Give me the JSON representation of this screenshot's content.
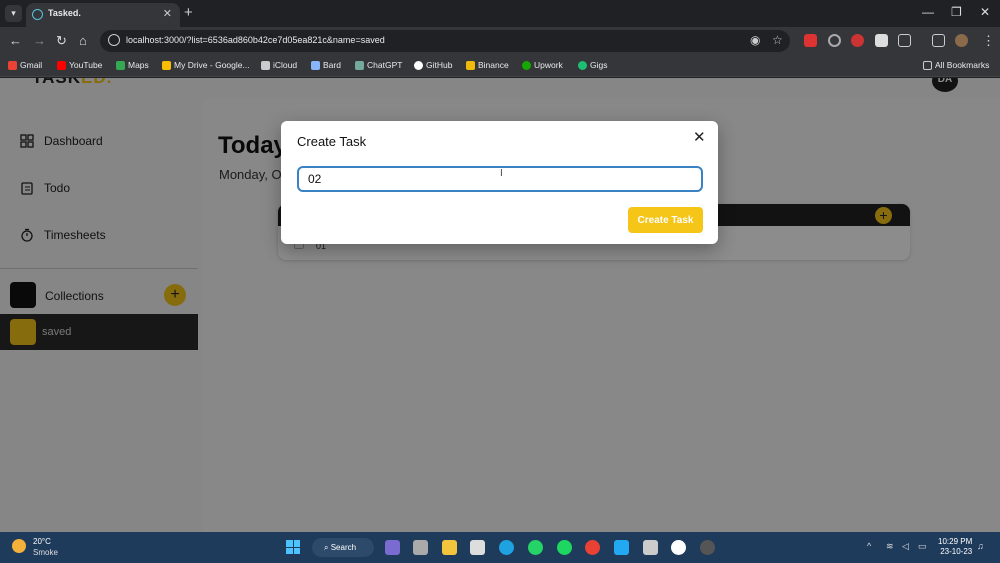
{
  "browser": {
    "tab_title": "Tasked.",
    "url": "localhost:3000/?list=6536ad860b42ce7d05ea821c&name=saved",
    "bookmarks": [
      "Gmail",
      "YouTube",
      "Maps",
      "My Drive - Google...",
      "iCloud",
      "Bard",
      "ChatGPT",
      "GitHub",
      "Binance",
      "Upwork",
      "Gigs"
    ],
    "all_bookmarks": "All Bookmarks"
  },
  "app": {
    "logo_main": "TASK",
    "logo_accent": "ED.",
    "avatar_initials": "DA",
    "sidebar": {
      "items": [
        {
          "label": "Dashboard",
          "icon": "grid-icon"
        },
        {
          "label": "Todo",
          "icon": "clipboard-icon"
        },
        {
          "label": "Timesheets",
          "icon": "timer-icon"
        }
      ],
      "collections_label": "Collections",
      "collections_add": "+",
      "saved_label": "saved"
    },
    "main": {
      "heading": "Today",
      "date": "Monday, O",
      "list_add": "+",
      "task": "01"
    }
  },
  "modal": {
    "title": "Create Task",
    "close": "✕",
    "input_value": "02",
    "button_label": "Create Task"
  },
  "taskbar": {
    "weather_temp": "20°C",
    "weather_condition": "Smoke",
    "search_label": "Search",
    "time": "10:29 PM",
    "date": "23-10-23"
  },
  "colors": {
    "accent": "#f5c518",
    "focus_border": "#3b82c4"
  }
}
